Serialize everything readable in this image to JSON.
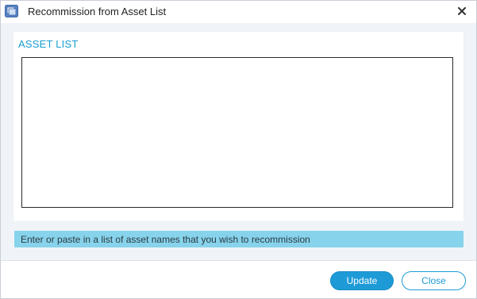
{
  "window": {
    "title": "Recommission from Asset List",
    "app_icon": "app-window-icon",
    "close_icon": "close-icon"
  },
  "panel": {
    "section_label": "ASSET LIST",
    "textarea_value": "",
    "textarea_placeholder": ""
  },
  "hint": {
    "text": "Enter or paste in a list of asset names that you wish to recommission"
  },
  "footer": {
    "update_label": "Update",
    "close_label": "Close"
  },
  "colors": {
    "accent": "#1e9bd7",
    "label": "#1a9fd0",
    "hint_bg": "#87d3eb"
  }
}
